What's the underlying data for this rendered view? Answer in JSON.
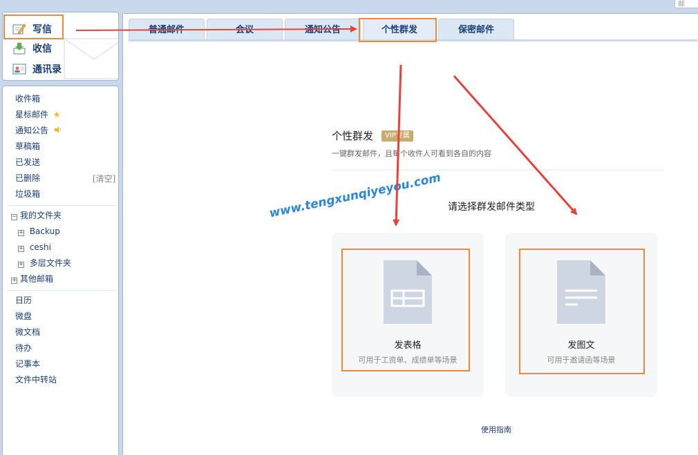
{
  "topbar": {
    "search_placeholder": "邮"
  },
  "quick_actions": {
    "write": "写信",
    "receive": "收信",
    "contacts": "通讯录"
  },
  "folders": {
    "inbox": "收件箱",
    "starred": "星标邮件",
    "notices": "通知公告",
    "drafts": "草稿箱",
    "sent": "已发送",
    "deleted": "已删除",
    "clear": "[清空]",
    "junk": "垃圾箱",
    "my_folders": "我的文件夹",
    "sub_folders": [
      "Backup",
      "ceshi",
      "多层文件夹"
    ],
    "other_mailboxes": "其他邮箱",
    "apps": [
      "日历",
      "微盘",
      "微文档",
      "待办",
      "记事本",
      "文件中转站"
    ]
  },
  "tabs": [
    "普通邮件",
    "会议",
    "通知公告",
    "个性群发",
    "保密邮件"
  ],
  "active_tab": "个性群发",
  "feature": {
    "title": "个性群发",
    "badge": "VIP专属",
    "description": "一键群发邮件，且每个收件人可看到各自的内容",
    "choose_label": "请选择群发邮件类型"
  },
  "watermark": "www.tengxunqiyeyou.com",
  "cards": [
    {
      "title": "发表格",
      "subtitle": "可用于工资单、成绩单等场景",
      "icon": "spreadsheet-doc-icon"
    },
    {
      "title": "发图文",
      "subtitle": "可用于邀请函等场景",
      "icon": "text-doc-icon"
    }
  ],
  "guide_link": "使用指南",
  "colors": {
    "highlight": "#f0883a",
    "arrow": "#e8403a",
    "nav_text": "#1b3f7a",
    "badge": "#c9ab6e",
    "watermark": "#2a86d9"
  }
}
